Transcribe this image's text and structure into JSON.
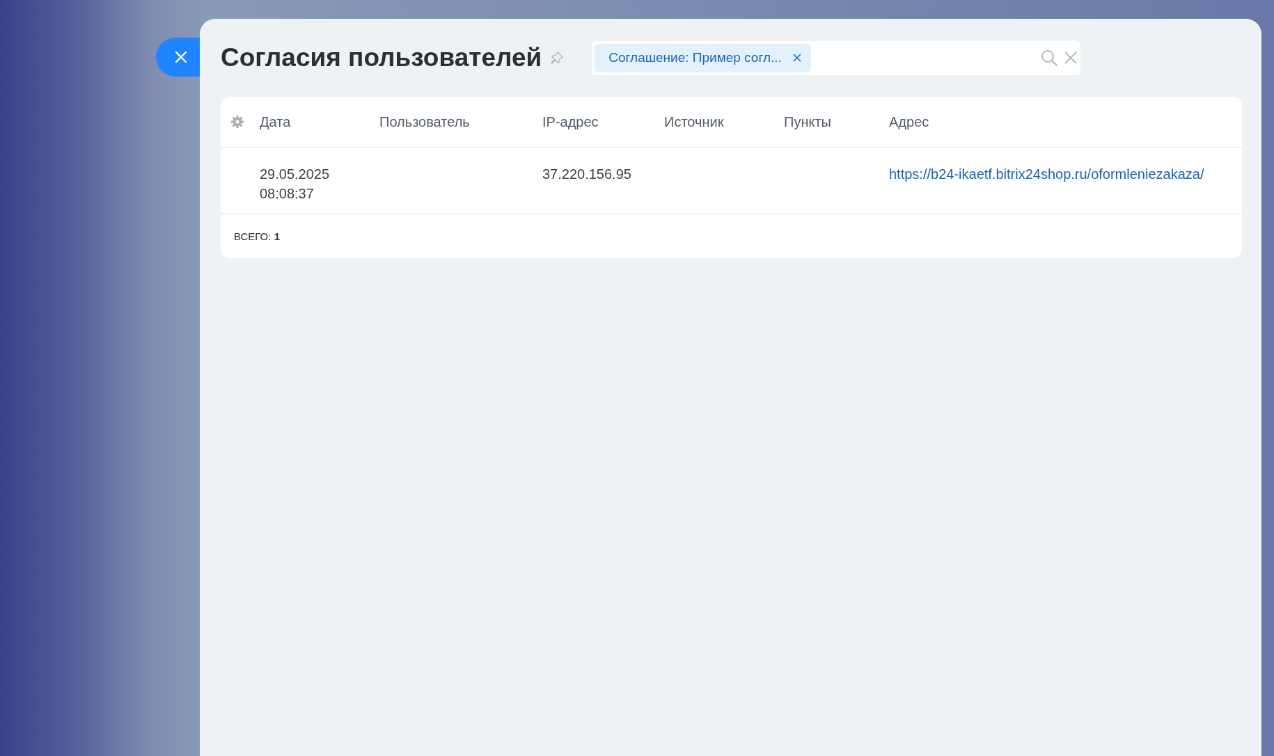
{
  "panel": {
    "title": "Согласия пользователей"
  },
  "filter": {
    "tags": [
      {
        "label": "Соглашение: Пример согл..."
      }
    ]
  },
  "table": {
    "columns": [
      "Дата",
      "Пользователь",
      "IP-адрес",
      "Источник",
      "Пункты",
      "Адрес"
    ],
    "rows": [
      {
        "cells": [
          {
            "kind": "text",
            "lines": [
              "29.05.2025",
              "08:08:37"
            ]
          },
          {
            "kind": "empty"
          },
          {
            "kind": "text",
            "lines": [
              "37.220.156.95"
            ]
          },
          {
            "kind": "empty"
          },
          {
            "kind": "empty"
          },
          {
            "kind": "link",
            "lines": [
              "https://b24-ikaetf.bitrix24shop.ru/oformleniezakaza/"
            ]
          }
        ]
      }
    ],
    "total": "ВСЕГО: **1**"
  }
}
